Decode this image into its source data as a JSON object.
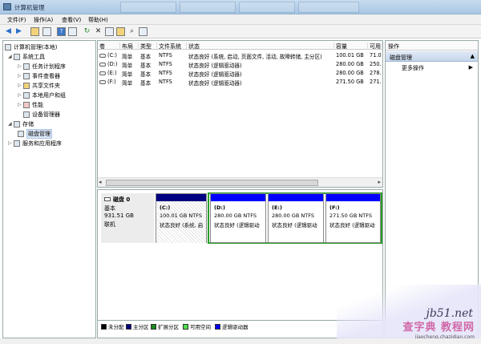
{
  "window": {
    "title": "计算机管理"
  },
  "menu": [
    "文件(F)",
    "操作(A)",
    "查看(V)",
    "帮助(H)"
  ],
  "tree": [
    {
      "label": "计算机管理(本地)",
      "indent": 0,
      "exp": "",
      "selected": false
    },
    {
      "label": "系统工具",
      "indent": 1,
      "exp": "◢",
      "selected": false
    },
    {
      "label": "任务计划程序",
      "indent": 2,
      "exp": "▷",
      "selected": false
    },
    {
      "label": "事件查看器",
      "indent": 2,
      "exp": "▷",
      "selected": false
    },
    {
      "label": "共享文件夹",
      "indent": 2,
      "exp": "▷",
      "selected": false
    },
    {
      "label": "本地用户和组",
      "indent": 2,
      "exp": "▷",
      "selected": false
    },
    {
      "label": "性能",
      "indent": 2,
      "exp": "▷",
      "selected": false
    },
    {
      "label": "设备管理器",
      "indent": 2,
      "exp": "",
      "selected": false
    },
    {
      "label": "存储",
      "indent": 1,
      "exp": "◢",
      "selected": false
    },
    {
      "label": "磁盘管理",
      "indent": 2,
      "exp": "",
      "selected": true
    },
    {
      "label": "服务和应用程序",
      "indent": 1,
      "exp": "▷",
      "selected": false
    }
  ],
  "volume_columns": [
    "卷",
    "布局",
    "类型",
    "文件系统",
    "状态",
    "容量",
    "可用"
  ],
  "volumes": [
    {
      "vol": "(C:)",
      "layout": "简单",
      "type": "基本",
      "fs": "NTFS",
      "status": "状态良好 (系统, 启动, 页面文件, 活动, 故障转储, 主分区)",
      "capacity": "100.01 GB",
      "free": "71.0"
    },
    {
      "vol": "(D:)",
      "layout": "简单",
      "type": "基本",
      "fs": "NTFS",
      "status": "状态良好 (逻辑驱动器)",
      "capacity": "280.00 GB",
      "free": "250."
    },
    {
      "vol": "(E:)",
      "layout": "简单",
      "type": "基本",
      "fs": "NTFS",
      "status": "状态良好 (逻辑驱动器)",
      "capacity": "280.00 GB",
      "free": "278."
    },
    {
      "vol": "(F:)",
      "layout": "简单",
      "type": "基本",
      "fs": "NTFS",
      "status": "状态良好 (逻辑驱动器)",
      "capacity": "271.50 GB",
      "free": "271."
    }
  ],
  "disk": {
    "name": "磁盘 0",
    "type": "基本",
    "size": "931.51 GB",
    "status": "联机"
  },
  "partitions": [
    {
      "name": "(C:)",
      "size": "100.01 GB NTFS",
      "status": "状态良好 (系统, 启",
      "bar_color": "#000080"
    },
    {
      "name": "(D:)",
      "size": "280.00 GB NTFS",
      "status": "状态良好 (逻辑驱动",
      "bar_color": "#0000ff"
    },
    {
      "name": "(E:)",
      "size": "280.00 GB NTFS",
      "status": "状态良好 (逻辑驱动",
      "bar_color": "#0000ff"
    },
    {
      "name": "(F:)",
      "size": "271.50 GB NTFS",
      "status": "状态良好 (逻辑驱动",
      "bar_color": "#0000ff"
    }
  ],
  "legend": [
    {
      "label": "未分配",
      "color": "#000000"
    },
    {
      "label": "主分区",
      "color": "#000080"
    },
    {
      "label": "扩展分区",
      "color": "#1a8a1a"
    },
    {
      "label": "可用空间",
      "color": "#4ce04c"
    },
    {
      "label": "逻辑驱动器",
      "color": "#0000ff"
    }
  ],
  "actions": {
    "header": "操作",
    "section": "磁盘管理",
    "more": "更多操作"
  },
  "watermark": {
    "site": "jb51.net",
    "text": "查字典 教程网",
    "url": "jiaocheng.chazidian.com"
  }
}
